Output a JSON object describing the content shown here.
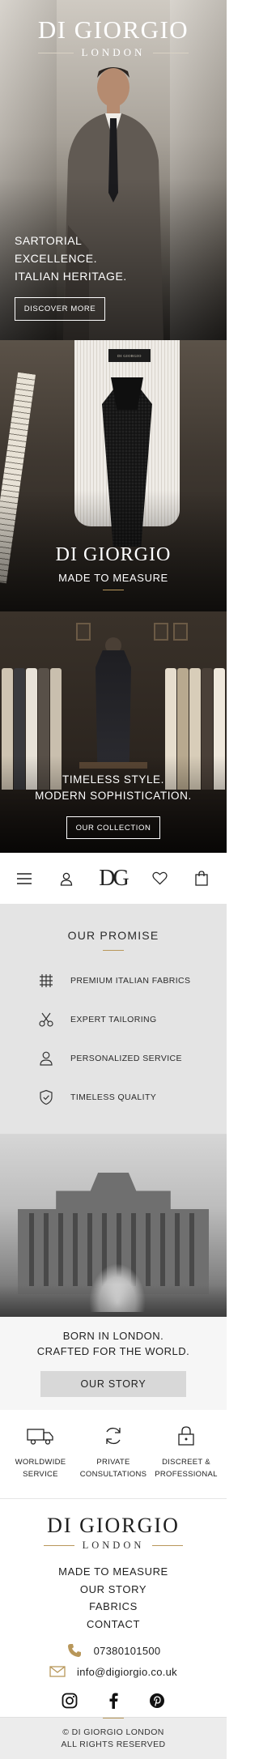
{
  "hero": {
    "brand_name": "DI GIORGIO",
    "brand_city": "LONDON",
    "headline_lines": [
      "SARTORIAL",
      "EXCELLENCE.",
      "ITALIAN HERITAGE."
    ],
    "cta_label": "DISCOVER MORE"
  },
  "made_to_measure": {
    "label_tag": "DI GIORGIO",
    "title": "DI GIORGIO",
    "subtitle": "MADE TO MEASURE"
  },
  "collection": {
    "headline_lines": [
      "TIMELESS STYLE.",
      "MODERN SOPHISTICATION."
    ],
    "cta_label": "OUR COLLECTION"
  },
  "nav": {
    "logo": "DG",
    "icons": [
      "menu-icon",
      "account-icon",
      "heart-icon",
      "bag-icon"
    ]
  },
  "promise": {
    "title": "OUR PROMISE",
    "items": [
      {
        "icon": "fabric-grid-icon",
        "label": "PREMIUM ITALIAN FABRICS"
      },
      {
        "icon": "scissors-icon",
        "label": "EXPERT TAILORING"
      },
      {
        "icon": "person-icon",
        "label": "PERSONALIZED SERVICE"
      },
      {
        "icon": "shield-check-icon",
        "label": "TIMELESS QUALITY"
      }
    ]
  },
  "heritage": {
    "lines": [
      "BORN IN LONDON.",
      "CRAFTED FOR THE WORLD."
    ],
    "cta_label": "OUR STORY"
  },
  "services": [
    {
      "icon": "truck-icon",
      "lines": [
        "WORLDWIDE",
        "SERVICE"
      ]
    },
    {
      "icon": "refresh-icon",
      "lines": [
        "PRIVATE",
        "CONSULTATIONS"
      ]
    },
    {
      "icon": "lock-icon",
      "lines": [
        "DISCREET &",
        "PROFESSIONAL"
      ]
    }
  ],
  "footer": {
    "brand_name": "DI GIORGIO",
    "brand_city": "LONDON",
    "links": [
      "MADE TO MEASURE",
      "OUR STORY",
      "FABRICS",
      "CONTACT"
    ],
    "phone": "07380101500",
    "email": "info@digiorgio.co.uk",
    "social": [
      "instagram-icon",
      "facebook-icon",
      "pinterest-icon"
    ],
    "copyright_lines": [
      "© DI GIORGIO LONDON",
      "ALL RIGHTS RESERVED"
    ]
  },
  "colors": {
    "accent_gold": "#b8975a",
    "promise_bg": "#e4e4e4",
    "story_button_bg": "#d8d8d8",
    "phone_icon": "#b8975a"
  }
}
